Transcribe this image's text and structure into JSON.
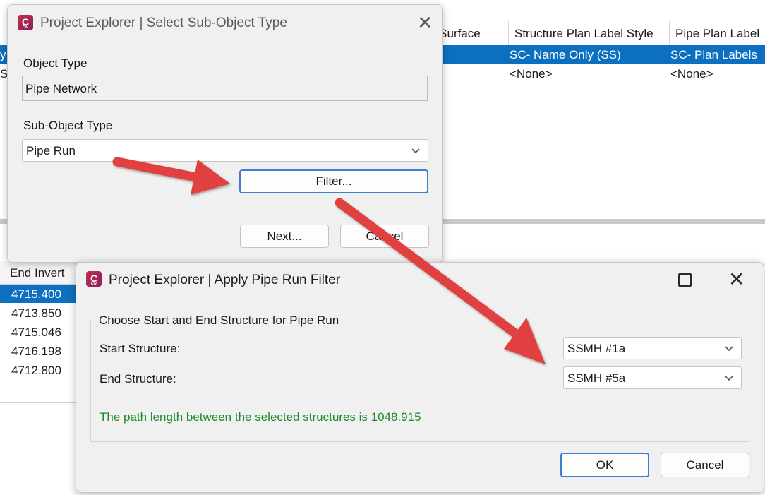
{
  "background": {
    "table_top": {
      "headers": [
        "e Surface",
        "Structure Plan Label Style",
        "Pipe Plan Label"
      ],
      "rows": [
        {
          "edge": "y",
          "cells": [
            "SC- Name Only (SS)",
            "SC- Plan Labels"
          ],
          "selected": true
        },
        {
          "edge": "S",
          "cells": [
            "<None>",
            "<None>"
          ],
          "selected": false
        }
      ]
    },
    "table_bottom": {
      "header": "End Invert",
      "rows": [
        "4715.400",
        "4713.850",
        "4715.046",
        "4716.198",
        "4712.800"
      ]
    }
  },
  "dialog_sub_object": {
    "title": "Project Explorer | Select Sub-Object Type",
    "object_type_label": "Object Type",
    "object_type_value": "Pipe Network",
    "sub_object_type_label": "Sub-Object Type",
    "sub_object_type_value": "Pipe Run",
    "filter_label": "Filter...",
    "next_label": "Next...",
    "cancel_label": "Cancel"
  },
  "dialog_pipe_run_filter": {
    "title": "Project Explorer | Apply Pipe Run Filter",
    "group_label": "Choose Start and End Structure for Pipe Run",
    "start_label": "Start Structure:",
    "start_value": "SSMH #1a",
    "end_label": "End Structure:",
    "end_value": "SSMH #5a",
    "path_message": "The path length between the selected structures is 1048.915",
    "ok_label": "OK",
    "cancel_label": "Cancel"
  },
  "icons": {
    "app": "civil3d-app-icon",
    "close": "close-icon",
    "minimize": "minimize-icon",
    "maximize": "maximize-icon",
    "dropdown": "chevron-down-icon",
    "annotation": "red-arrow-icon"
  },
  "colors": {
    "selection": "#0d6fbf",
    "accent_border": "#3a7fd1",
    "success_text": "#1d8a2a",
    "annotation_arrow": "#e04040"
  }
}
